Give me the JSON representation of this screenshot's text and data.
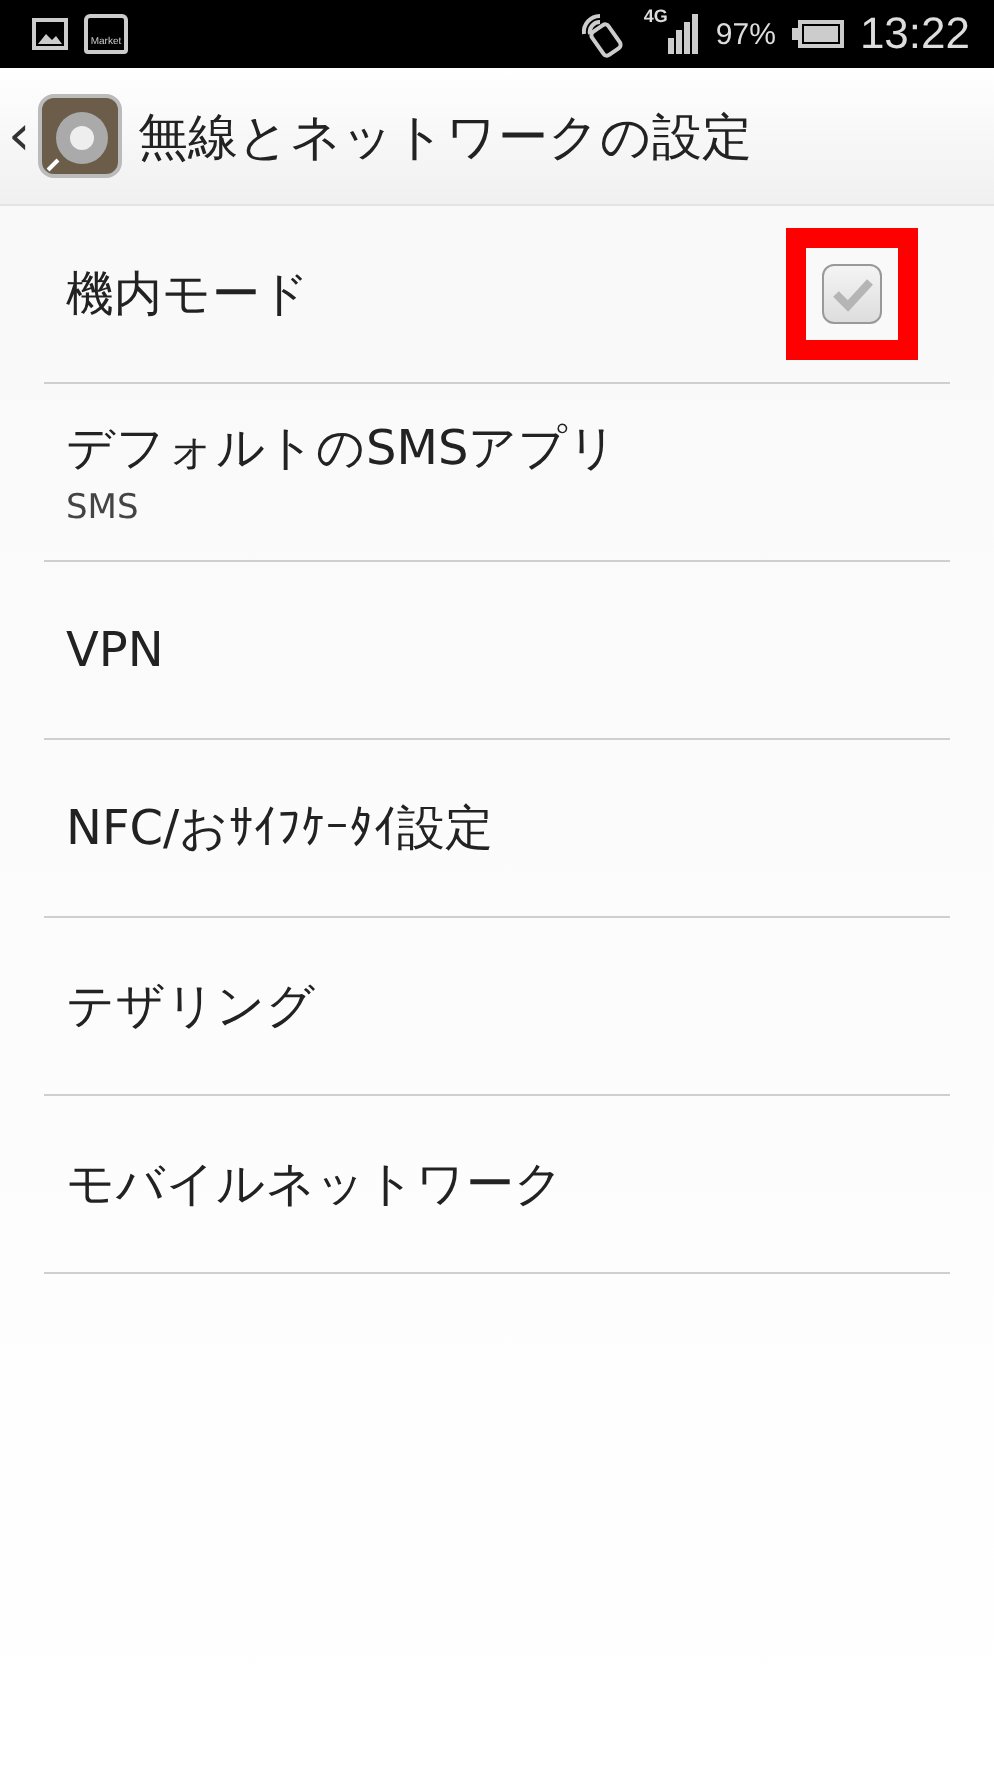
{
  "status_bar": {
    "market_label": "Market",
    "network": "4G",
    "battery": "97%",
    "time": "13:22"
  },
  "header": {
    "back": "‹",
    "title": "無線とネットワークの設定"
  },
  "items": [
    {
      "kind": "checkbox",
      "title": "機内モード",
      "checked": true,
      "highlighted": true
    },
    {
      "kind": "text",
      "title": "デフォルトのSMSアプリ",
      "summary": "SMS"
    },
    {
      "kind": "text",
      "title": "VPN"
    },
    {
      "kind": "text",
      "title": "NFC/おｻｲﾌｹｰﾀｲ設定"
    },
    {
      "kind": "text",
      "title": "テザリング"
    },
    {
      "kind": "text",
      "title": "モバイルネットワーク"
    }
  ]
}
